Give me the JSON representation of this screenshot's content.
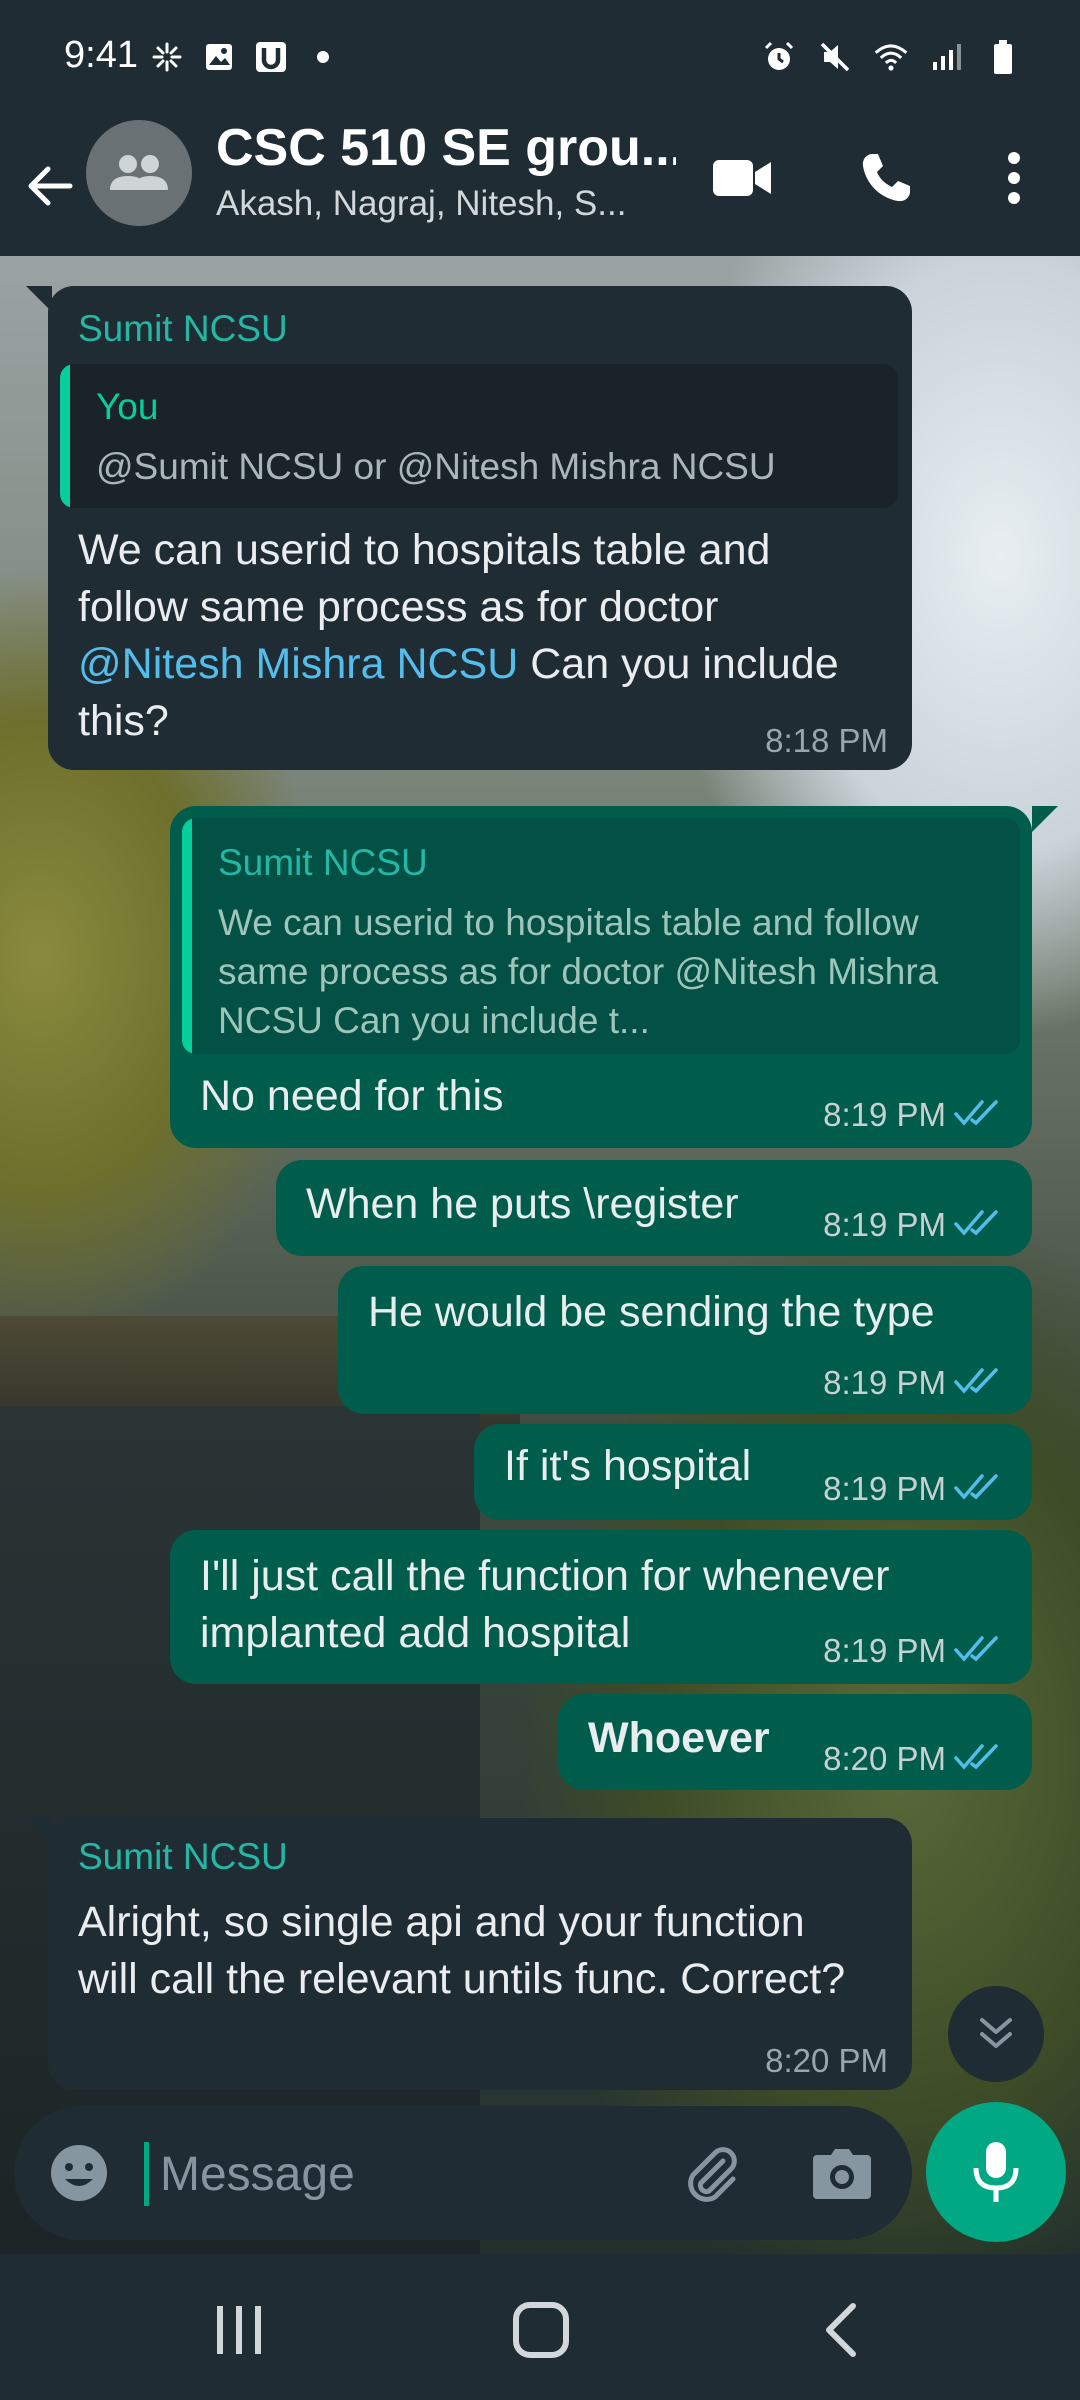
{
  "status_bar": {
    "time": "9:41",
    "left_icons": [
      "spark-icon",
      "gallery-icon",
      "u-app-icon",
      "dot-icon"
    ],
    "right_icons": [
      "alarm-icon",
      "mute-icon",
      "wifi-icon",
      "signal-icon",
      "battery-icon"
    ]
  },
  "header": {
    "title": "CSC 510 SE grou...",
    "subtitle": "Akash, Nagraj, Nitesh, S...",
    "actions": [
      "video-call-icon",
      "voice-call-icon",
      "more-menu-icon"
    ]
  },
  "messages": [
    {
      "direction": "incoming",
      "sender": "Sumit NCSU",
      "quote": {
        "author": "You",
        "text": "@Sumit NCSU or @Nitesh Mishra NCSU"
      },
      "text_part1": "We can userid to hospitals table and follow same process as for doctor ",
      "mention": "@Nitesh Mishra NCSU",
      "text_part2": " Can you include this?",
      "time": "8:18 PM"
    },
    {
      "direction": "outgoing",
      "quote": {
        "author": "Sumit NCSU",
        "text": "We can userid to hospitals table and follow same process as for doctor @Nitesh Mishra NCSU Can you include t..."
      },
      "text": "No need for this",
      "time": "8:19 PM",
      "status": "read"
    },
    {
      "direction": "outgoing",
      "text": "When he puts \\register",
      "time": "8:19 PM",
      "status": "read"
    },
    {
      "direction": "outgoing",
      "text": "He would be sending the type",
      "time": "8:19 PM",
      "status": "read"
    },
    {
      "direction": "outgoing",
      "text": "If it's hospital",
      "time": "8:19 PM",
      "status": "read"
    },
    {
      "direction": "outgoing",
      "text": "I'll just call the function for whenever implanted add hospital",
      "time": "8:19 PM",
      "status": "read"
    },
    {
      "direction": "outgoing",
      "text": "Whoever",
      "time": "8:20 PM",
      "status": "read",
      "bold": true
    },
    {
      "direction": "incoming",
      "sender": "Sumit NCSU",
      "text": "Alright, so single api and your function will call the relevant untils func. Correct?",
      "time": "8:20 PM"
    }
  ],
  "composer": {
    "placeholder": "Message",
    "icons": [
      "emoji-icon",
      "attach-icon",
      "camera-icon",
      "mic-icon"
    ]
  },
  "colors": {
    "header_bg": "#1f2c34",
    "incoming_bubble": "#202c33",
    "outgoing_bubble": "#005c4b",
    "accent": "#00a884",
    "sender_name": "#25b7a5",
    "read_ticks": "#53bdeb"
  },
  "nav_bar": [
    "recents-icon",
    "home-icon",
    "back-nav-icon"
  ]
}
